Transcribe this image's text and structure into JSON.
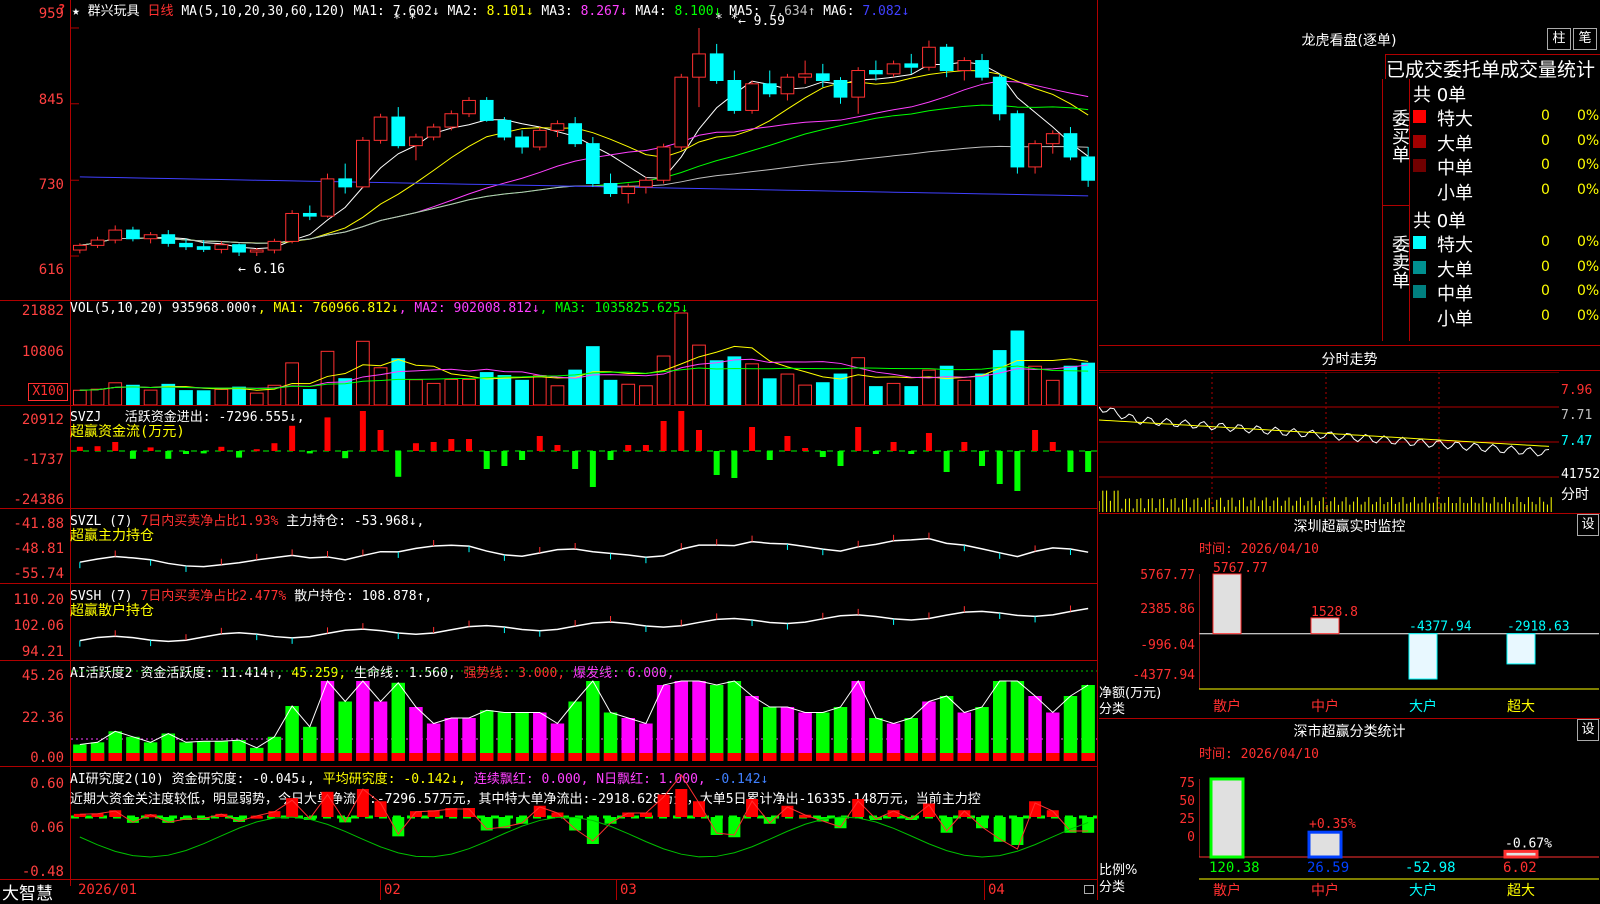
{
  "main": {
    "title_star": "★",
    "stock_name": "群兴玩具",
    "period": "日线",
    "ma_params": "MA(5,10,20,30,60,120)",
    "ma_items": [
      {
        "label": "MA1:",
        "value": "7.602↓",
        "color": "#ffffff"
      },
      {
        "label": "MA2:",
        "value": "8.101↓",
        "color": "#ffff00"
      },
      {
        "label": "MA3:",
        "value": "8.267↓",
        "color": "#ff40ff"
      },
      {
        "label": "MA4:",
        "value": "8.100↓",
        "color": "#00ff00"
      },
      {
        "label": "MA5:",
        "value": "7.634↑",
        "color": "#c0c0c0"
      },
      {
        "label": "MA6:",
        "value": "7.082↓",
        "color": "#4040ff"
      }
    ],
    "y_ticks": [
      "959",
      "845",
      "730",
      "616"
    ],
    "high_mark": "9.59",
    "low_mark": "6.16"
  },
  "vol": {
    "name": "VOL(5,10,20)",
    "value": "935968.000↑",
    "ma_items": [
      {
        "label": "MA1:",
        "value": "760966.812↓",
        "color": "#ffff00"
      },
      {
        "label": "MA2:",
        "value": "902008.812↓",
        "color": "#ff40ff"
      },
      {
        "label": "MA3:",
        "value": "1035825.625↓",
        "color": "#00ff00"
      }
    ],
    "y_ticks": [
      "21882",
      "10806"
    ],
    "unit": "X100"
  },
  "svzj": {
    "name": "SVZJ",
    "label": "活跃资金进出:",
    "value": "-7296.555↓,",
    "sub": "超赢资金流(万元)",
    "y_ticks": [
      "20912",
      "-1737",
      "-24386"
    ]
  },
  "svzl": {
    "name": "SVZL (7)",
    "label1": "7日内买卖净占比1.93%",
    "label2": "主力持仓:",
    "value": "-53.968↓,",
    "sub": "超赢主力持仓",
    "y_ticks": [
      "-41.88",
      "-48.81",
      "-55.74"
    ]
  },
  "svsh": {
    "name": "SVSH (7)",
    "label1": "7日内买卖净占比2.477%",
    "label2": "散户持仓:",
    "value": "108.878↑,",
    "sub": "超赢散户持仓",
    "y_ticks": [
      "110.20",
      "102.06",
      "94.21"
    ]
  },
  "act": {
    "name": "AI活跃度2",
    "label": "资金活跃度:",
    "value": "11.414↑,",
    "v2": "45.259,",
    "life": "生命线: 1.560,",
    "strong": "强势线: 3.000,",
    "burst": "爆发线: 6.000,",
    "y_ticks": [
      "45.26",
      "22.36",
      "0.00"
    ]
  },
  "research": {
    "name": "AI研究度2(10)",
    "label": "资金研究度:",
    "value": "-0.045↓,",
    "avg": "平均研究度: -0.142↓,",
    "red": "连续飘红: 0.000,",
    "nred": "N日飘红: 1.000,",
    "last": "-0.142↓",
    "comment": "近期大资金关注度较低，明显弱势，今日大单净流出:-7296.57万元，其中特大单净流出:-2918.628万元，大单5日累计净出-16335.148万元，当前主力控",
    "y_ticks": [
      "0.60",
      "0.06",
      "-0.48"
    ]
  },
  "xaxis": {
    "brand": "大智慧",
    "labels": [
      "2026/01",
      "02",
      "03",
      "04"
    ]
  },
  "lhb": {
    "title": "龙虎看盘(逐单)",
    "btn1": "柱",
    "btn2": "笔",
    "header": "已成交委托单成交量统计",
    "buy_label": "委买单",
    "sell_label": "委卖单",
    "buy_total": "共 0单",
    "sell_total": "共 0单",
    "buy_rows": [
      {
        "name": "特大",
        "count": "0",
        "pct": "0%",
        "color": "#ff0000"
      },
      {
        "name": "大单",
        "count": "0",
        "pct": "0%",
        "color": "#a00000"
      },
      {
        "name": "中单",
        "count": "0",
        "pct": "0%",
        "color": "#700000"
      },
      {
        "name": "小单",
        "count": "0",
        "pct": "0%",
        "color": "#000000"
      }
    ],
    "sell_rows": [
      {
        "name": "特大",
        "count": "0",
        "pct": "0%",
        "color": "#00ffff"
      },
      {
        "name": "大单",
        "count": "0",
        "pct": "0%",
        "color": "#009090"
      },
      {
        "name": "中单",
        "count": "0",
        "pct": "0%",
        "color": "#008080"
      },
      {
        "name": "小单",
        "count": "0",
        "pct": "0%",
        "color": "#000000"
      }
    ]
  },
  "intraday": {
    "title": "分时走势",
    "y_ticks": [
      "7.96",
      "7.71",
      "7.47",
      "41752"
    ],
    "footer": "分时"
  },
  "monitor": {
    "title": "深圳超赢实时监控",
    "settings": "设",
    "time": "时间: 2026/04/10",
    "y_ticks": [
      "5767.77",
      "2385.86",
      "-996.04",
      "-4377.94"
    ],
    "ylabel": "净额(万元)",
    "xlabel": "分类",
    "categories": [
      "散户",
      "中户",
      "大户",
      "超大"
    ],
    "values": [
      5767.77,
      1528.8,
      -4377.94,
      -2918.63
    ],
    "value_labels": [
      "5767.77",
      "1528.8",
      "-4377.94",
      "-2918.63"
    ]
  },
  "stats": {
    "title": "深市超赢分类统计",
    "settings": "设",
    "time": "时间: 2026/04/10",
    "y_ticks": [
      "75",
      "50",
      "25",
      "0"
    ],
    "ylabel": "比例%",
    "xlabel": "分类",
    "categories": [
      "散户",
      "中户",
      "大户",
      "超大"
    ],
    "values": [
      120.38,
      26.59,
      -52.98,
      6.02
    ],
    "value_labels": [
      "120.38",
      "26.59",
      "-52.98",
      "6.02"
    ],
    "changes": [
      "",
      "+0.35%",
      "",
      "-0.67%"
    ]
  },
  "chart_data": [
    {
      "type": "candlestick",
      "title": "群兴玩具 日线",
      "ylim": [
        6.16,
        9.59
      ],
      "y_ticks": [
        9.59,
        8.45,
        7.3,
        6.16
      ],
      "x_labels": [
        "2026/01",
        "02",
        "03",
        "04"
      ],
      "ohlc": [
        [
          6.25,
          6.35,
          6.2,
          6.32
        ],
        [
          6.32,
          6.45,
          6.28,
          6.4
        ],
        [
          6.4,
          6.62,
          6.35,
          6.55
        ],
        [
          6.55,
          6.6,
          6.38,
          6.42
        ],
        [
          6.42,
          6.52,
          6.35,
          6.48
        ],
        [
          6.48,
          6.55,
          6.3,
          6.35
        ],
        [
          6.35,
          6.42,
          6.25,
          6.3
        ],
        [
          6.3,
          6.4,
          6.22,
          6.26
        ],
        [
          6.26,
          6.38,
          6.2,
          6.33
        ],
        [
          6.33,
          6.35,
          6.16,
          6.22
        ],
        [
          6.22,
          6.28,
          6.16,
          6.25
        ],
        [
          6.25,
          6.42,
          6.2,
          6.38
        ],
        [
          6.38,
          6.85,
          6.35,
          6.8
        ],
        [
          6.8,
          6.92,
          6.7,
          6.76
        ],
        [
          6.76,
          7.4,
          6.74,
          7.32
        ],
        [
          7.32,
          7.55,
          7.1,
          7.2
        ],
        [
          7.2,
          7.95,
          7.18,
          7.9
        ],
        [
          7.9,
          8.3,
          7.85,
          8.25
        ],
        [
          8.25,
          8.4,
          7.78,
          7.82
        ],
        [
          7.82,
          8.0,
          7.6,
          7.95
        ],
        [
          7.95,
          8.15,
          7.9,
          8.1
        ],
        [
          8.1,
          8.35,
          8.05,
          8.3
        ],
        [
          8.3,
          8.55,
          8.25,
          8.5
        ],
        [
          8.5,
          8.55,
          8.18,
          8.2
        ],
        [
          8.2,
          8.25,
          7.9,
          7.95
        ],
        [
          7.95,
          8.05,
          7.7,
          7.8
        ],
        [
          7.8,
          8.1,
          7.75,
          8.05
        ],
        [
          8.05,
          8.2,
          7.95,
          8.15
        ],
        [
          8.15,
          8.25,
          7.8,
          7.85
        ],
        [
          7.85,
          7.95,
          7.2,
          7.25
        ],
        [
          7.25,
          7.4,
          7.05,
          7.1
        ],
        [
          7.1,
          7.25,
          6.95,
          7.2
        ],
        [
          7.2,
          7.35,
          7.1,
          7.3
        ],
        [
          7.3,
          7.85,
          7.25,
          7.8
        ],
        [
          7.8,
          8.9,
          7.75,
          8.85
        ],
        [
          8.85,
          9.59,
          8.4,
          9.2
        ],
        [
          9.2,
          9.35,
          8.75,
          8.8
        ],
        [
          8.8,
          8.95,
          8.3,
          8.35
        ],
        [
          8.35,
          8.8,
          8.3,
          8.75
        ],
        [
          8.75,
          8.95,
          8.55,
          8.6
        ],
        [
          8.6,
          8.9,
          8.5,
          8.85
        ],
        [
          8.85,
          9.1,
          8.75,
          8.9
        ],
        [
          8.9,
          9.05,
          8.7,
          8.8
        ],
        [
          8.8,
          8.85,
          8.45,
          8.55
        ],
        [
          8.55,
          9.0,
          8.3,
          8.95
        ],
        [
          8.95,
          9.1,
          8.8,
          8.9
        ],
        [
          8.9,
          9.1,
          8.85,
          9.05
        ],
        [
          9.05,
          9.2,
          8.9,
          9.0
        ],
        [
          9.0,
          9.4,
          8.95,
          9.3
        ],
        [
          9.3,
          9.35,
          8.85,
          8.95
        ],
        [
          8.95,
          9.15,
          8.8,
          9.1
        ],
        [
          9.1,
          9.2,
          8.8,
          8.85
        ],
        [
          8.85,
          8.9,
          8.2,
          8.3
        ],
        [
          8.3,
          8.35,
          7.4,
          7.5
        ],
        [
          7.5,
          7.9,
          7.4,
          7.85
        ],
        [
          7.85,
          8.05,
          7.7,
          8.0
        ],
        [
          8.0,
          8.1,
          7.6,
          7.65
        ],
        [
          7.65,
          7.8,
          7.2,
          7.3
        ]
      ]
    }
  ]
}
